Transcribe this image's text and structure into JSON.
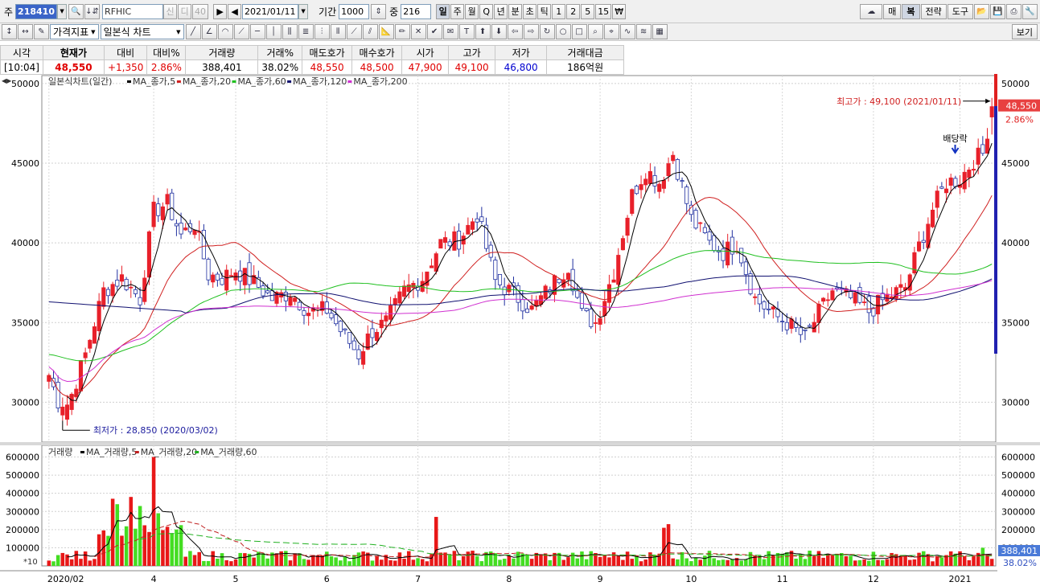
{
  "toolbar1": {
    "type_label": "주",
    "code": "218410",
    "name": "RFHIC",
    "name_btns": [
      "신",
      "디",
      "40"
    ],
    "date": "2021/01/11",
    "period_label": "기간",
    "period_value": "1000",
    "count_label": "중",
    "count_value": "216",
    "periods": [
      "일",
      "주",
      "월",
      "Q",
      "년",
      "분",
      "초",
      "틱",
      "1",
      "2",
      "5",
      "15",
      "₩"
    ],
    "periods_selected": "일",
    "right_buttons": [
      "매",
      "복",
      "전략",
      "도구"
    ]
  },
  "toolbar2": {
    "indicator_btn": "가격지표",
    "chart_type": "일본식 차트",
    "view_btn": "보기"
  },
  "quote": {
    "headers": [
      "시각",
      "현재가",
      "대비",
      "대비%",
      "거래량",
      "거래%",
      "매도호가",
      "매수호가",
      "시가",
      "고가",
      "저가",
      "거래대금"
    ],
    "values": [
      "[10:04]",
      "48,550",
      "+1,350",
      "2.86%",
      "388,401",
      "38.02%",
      "48,550",
      "48,500",
      "47,900",
      "49,100",
      "46,800",
      "186억원"
    ]
  },
  "colors": {
    "up": "#e8202a",
    "down": "#2030a0",
    "ma5": "#000000",
    "ma20": "#d02020",
    "ma60": "#20c020",
    "ma120": "#101070",
    "ma200": "#d030d0",
    "vol_up": "#e81818",
    "vol_down": "#44dd22"
  },
  "chart_data": {
    "type": "candlestick",
    "price_title": "일본식차트(일간)",
    "ma_legend": [
      "MA_종가,5",
      "MA_종가,20",
      "MA_종가,60",
      "MA_종가,120",
      "MA_종가,200"
    ],
    "volume_title": "거래량",
    "vol_legend": [
      "MA_거래량,5",
      "MA_거래량,20",
      "MA_거래량,60"
    ],
    "price_yticks": [
      "50000",
      "45000",
      "40000",
      "35000",
      "30000"
    ],
    "price_ylim": [
      27500,
      50500
    ],
    "volume_yticks": [
      "600000",
      "500000",
      "400000",
      "300000",
      "200000",
      "100000"
    ],
    "volume_ylim": [
      0,
      620000
    ],
    "vol_scale_label": "*10",
    "x_labels": [
      "2020/02",
      "4",
      "5",
      "6",
      "7",
      "8",
      "9",
      "10",
      "11",
      "12",
      "2021"
    ],
    "x_label_bar_index": [
      0,
      23,
      41,
      61,
      81,
      101,
      121,
      141,
      161,
      181,
      200
    ],
    "bar_count": 208,
    "key_closes": [
      [
        0,
        31700
      ],
      [
        3,
        29300
      ],
      [
        5,
        30500
      ],
      [
        8,
        33000
      ],
      [
        12,
        37000
      ],
      [
        16,
        37800
      ],
      [
        20,
        36500
      ],
      [
        23,
        42000
      ],
      [
        26,
        42500
      ],
      [
        29,
        40500
      ],
      [
        32,
        41200
      ],
      [
        35,
        38000
      ],
      [
        38,
        37800
      ],
      [
        41,
        38300
      ],
      [
        45,
        37500
      ],
      [
        49,
        36500
      ],
      [
        53,
        36900
      ],
      [
        57,
        35700
      ],
      [
        61,
        35800
      ],
      [
        64,
        34500
      ],
      [
        68,
        33000
      ],
      [
        71,
        34500
      ],
      [
        74,
        35000
      ],
      [
        78,
        37000
      ],
      [
        82,
        37800
      ],
      [
        86,
        40000
      ],
      [
        90,
        40200
      ],
      [
        94,
        41800
      ],
      [
        98,
        37600
      ],
      [
        102,
        36800
      ],
      [
        106,
        35800
      ],
      [
        110,
        37200
      ],
      [
        114,
        38600
      ],
      [
        117,
        35500
      ],
      [
        120,
        35000
      ],
      [
        124,
        38200
      ],
      [
        128,
        43000
      ],
      [
        131,
        44600
      ],
      [
        134,
        43800
      ],
      [
        137,
        45600
      ],
      [
        141,
        41500
      ],
      [
        145,
        40000
      ],
      [
        148,
        39400
      ],
      [
        151,
        40000
      ],
      [
        155,
        36500
      ],
      [
        159,
        35500
      ],
      [
        162,
        35000
      ],
      [
        166,
        34000
      ],
      [
        169,
        35600
      ],
      [
        172,
        37000
      ],
      [
        176,
        36500
      ],
      [
        180,
        35700
      ],
      [
        184,
        36600
      ],
      [
        188,
        37200
      ],
      [
        191,
        39800
      ],
      [
        194,
        42100
      ],
      [
        197,
        43800
      ],
      [
        200,
        44000
      ],
      [
        203,
        45200
      ],
      [
        205,
        45600
      ],
      [
        207,
        48550
      ]
    ],
    "volume_spikes": [
      [
        14,
        370000
      ],
      [
        15,
        340000
      ],
      [
        18,
        380000
      ],
      [
        20,
        330000
      ],
      [
        23,
        600000
      ],
      [
        24,
        290000
      ],
      [
        85,
        270000
      ],
      [
        135,
        210000
      ],
      [
        136,
        230000
      ],
      [
        198,
        80000
      ],
      [
        205,
        100000
      ]
    ],
    "high_marker": {
      "label": "최고가 : 49,100 (2021/01/11)",
      "value": 49100,
      "bar": 207
    },
    "low_marker": {
      "label": "최저가 : 28,850 (2020/03/02)",
      "value": 28850,
      "bar": 3
    },
    "event_marker": {
      "label": "배당락",
      "bar": 200
    },
    "last_price_tag": "48,550",
    "last_pct_tag": "2.86%",
    "last_volume_tag": "388,401",
    "last_volume_pct_tag": "38.02%",
    "last_volume": 38840
  }
}
